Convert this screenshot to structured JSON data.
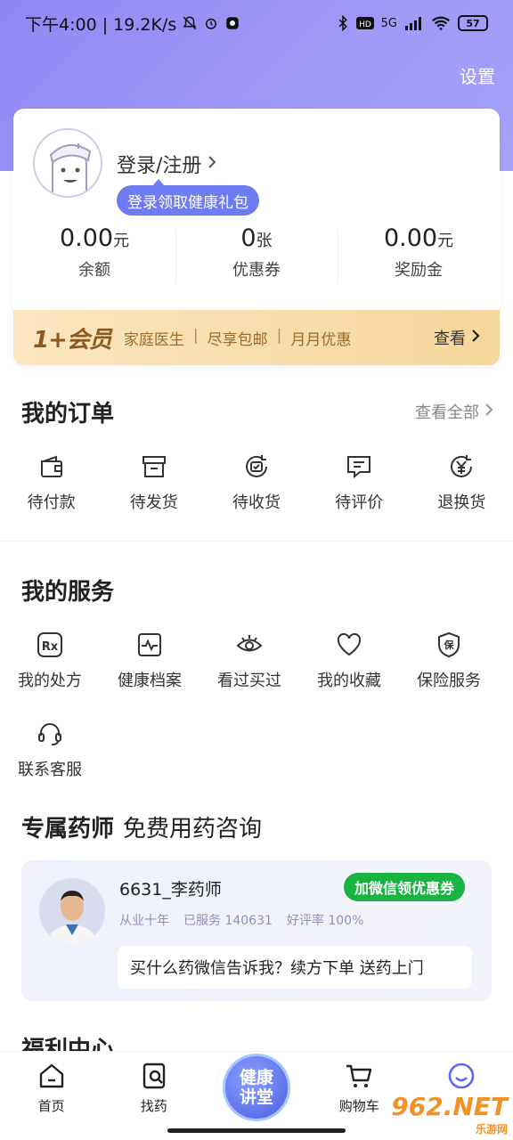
{
  "status_bar": {
    "time_speed": "下午4:00 | 19.2K/s",
    "network": "5G",
    "battery": "57"
  },
  "header": {
    "settings_label": "设置"
  },
  "user_card": {
    "login_label": "登录/注册",
    "login_tip": "登录领取健康礼包",
    "stats": [
      {
        "value": "0.00",
        "unit": "元",
        "label": "余额"
      },
      {
        "value": "0",
        "unit": "张",
        "label": "优惠券"
      },
      {
        "value": "0.00",
        "unit": "元",
        "label": "奖励金"
      }
    ],
    "vip": {
      "logo": "1+会员",
      "perks": [
        "家庭医生",
        "尽享包邮",
        "月月优惠"
      ],
      "separator": "|",
      "more_label": "查看"
    }
  },
  "orders": {
    "title": "我的订单",
    "see_all": "查看全部",
    "items": [
      {
        "label": "待付款",
        "icon": "wallet-icon"
      },
      {
        "label": "待发货",
        "icon": "box-icon"
      },
      {
        "label": "待收货",
        "icon": "receive-icon"
      },
      {
        "label": "待评价",
        "icon": "comment-icon"
      },
      {
        "label": "退换货",
        "icon": "refund-icon"
      }
    ]
  },
  "services": {
    "title": "我的服务",
    "items": [
      {
        "label": "我的处方",
        "icon": "rx-icon"
      },
      {
        "label": "健康档案",
        "icon": "pulse-icon"
      },
      {
        "label": "看过买过",
        "icon": "eye-icon"
      },
      {
        "label": "我的收藏",
        "icon": "heart-icon"
      },
      {
        "label": "保险服务",
        "icon": "shield-icon"
      },
      {
        "label": "联系客服",
        "icon": "headset-icon"
      }
    ]
  },
  "pharmacist": {
    "title": "专属药师",
    "subtitle": "免费用药咨询",
    "name": "6631_李药师",
    "wechat_button": "加微信领优惠券",
    "meta": [
      "从业十年",
      "已服务 140631",
      "好评率 100%"
    ],
    "message": "买什么药微信告诉我？续方下单 送药上门"
  },
  "welfare": {
    "title": "福利中心"
  },
  "tabbar": {
    "items": [
      "首页",
      "找药",
      "购物车"
    ],
    "center_line1": "健康",
    "center_line2": "讲堂",
    "center_badge": "..."
  },
  "watermark": {
    "text": "962.NET",
    "sub": "乐游网"
  },
  "colors": {
    "header_gradient": "#9a93f6",
    "accent": "#6e7cf2",
    "vip_gold": "#f6d69a",
    "wechat_green": "#18b341"
  }
}
